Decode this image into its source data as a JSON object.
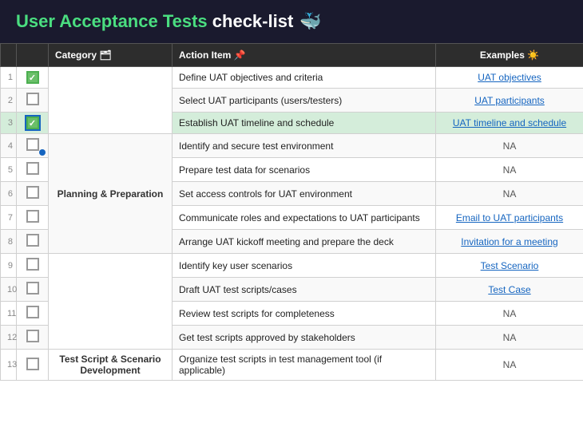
{
  "header": {
    "title_normal": "User Acceptance Tests ",
    "title_bold": "check-list",
    "emoji": "🐳"
  },
  "columns": {
    "num_label": "",
    "check_label": "",
    "category_label": "Category 🗂",
    "action_label": "Action Item 📌",
    "examples_label": "Examples ☀️"
  },
  "rows": [
    {
      "num": "1",
      "checked": true,
      "category": "",
      "action": "Define UAT objectives and criteria",
      "example": "UAT objectives",
      "example_type": "link"
    },
    {
      "num": "2",
      "checked": false,
      "category": "",
      "action": "Select UAT participants (users/testers)",
      "example": "UAT participants",
      "example_type": "link"
    },
    {
      "num": "3",
      "checked": true,
      "category": "",
      "action": "Establish UAT timeline and schedule",
      "example": "UAT timeline and schedule",
      "example_type": "link",
      "highlight": true
    },
    {
      "num": "4",
      "checked": false,
      "category": "Planning & Preparation",
      "action": "Identify and secure test environment",
      "example": "NA",
      "example_type": "na"
    },
    {
      "num": "5",
      "checked": false,
      "category": "",
      "action": "Prepare test data for scenarios",
      "example": "NA",
      "example_type": "na"
    },
    {
      "num": "6",
      "checked": false,
      "category": "",
      "action": "Set access controls for UAT environment",
      "example": "NA",
      "example_type": "na"
    },
    {
      "num": "7",
      "checked": false,
      "category": "",
      "action": "Communicate roles and expectations to UAT participants",
      "example": "Email to UAT participants",
      "example_type": "link"
    },
    {
      "num": "8",
      "checked": false,
      "category": "",
      "action": "Arrange UAT kickoff meeting and prepare the deck",
      "example": "Invitation for a meeting",
      "example_type": "link"
    },
    {
      "num": "9",
      "checked": false,
      "category": "",
      "action": "Identify key user scenarios",
      "example": "Test Scenario",
      "example_type": "link"
    },
    {
      "num": "10",
      "checked": false,
      "category": "",
      "action": "Draft UAT test scripts/cases",
      "example": "Test Case",
      "example_type": "link"
    },
    {
      "num": "11",
      "checked": false,
      "category": "",
      "action": "Review test scripts for completeness",
      "example": "NA",
      "example_type": "na"
    },
    {
      "num": "12",
      "checked": false,
      "category": "Test Script & Scenario\nDevelopment",
      "action": "Get test scripts approved by stakeholders",
      "example": "NA",
      "example_type": "na"
    },
    {
      "num": "13",
      "checked": false,
      "category": "",
      "action": "Organize test scripts in test management tool (if applicable)",
      "example": "NA",
      "example_type": "na"
    }
  ]
}
